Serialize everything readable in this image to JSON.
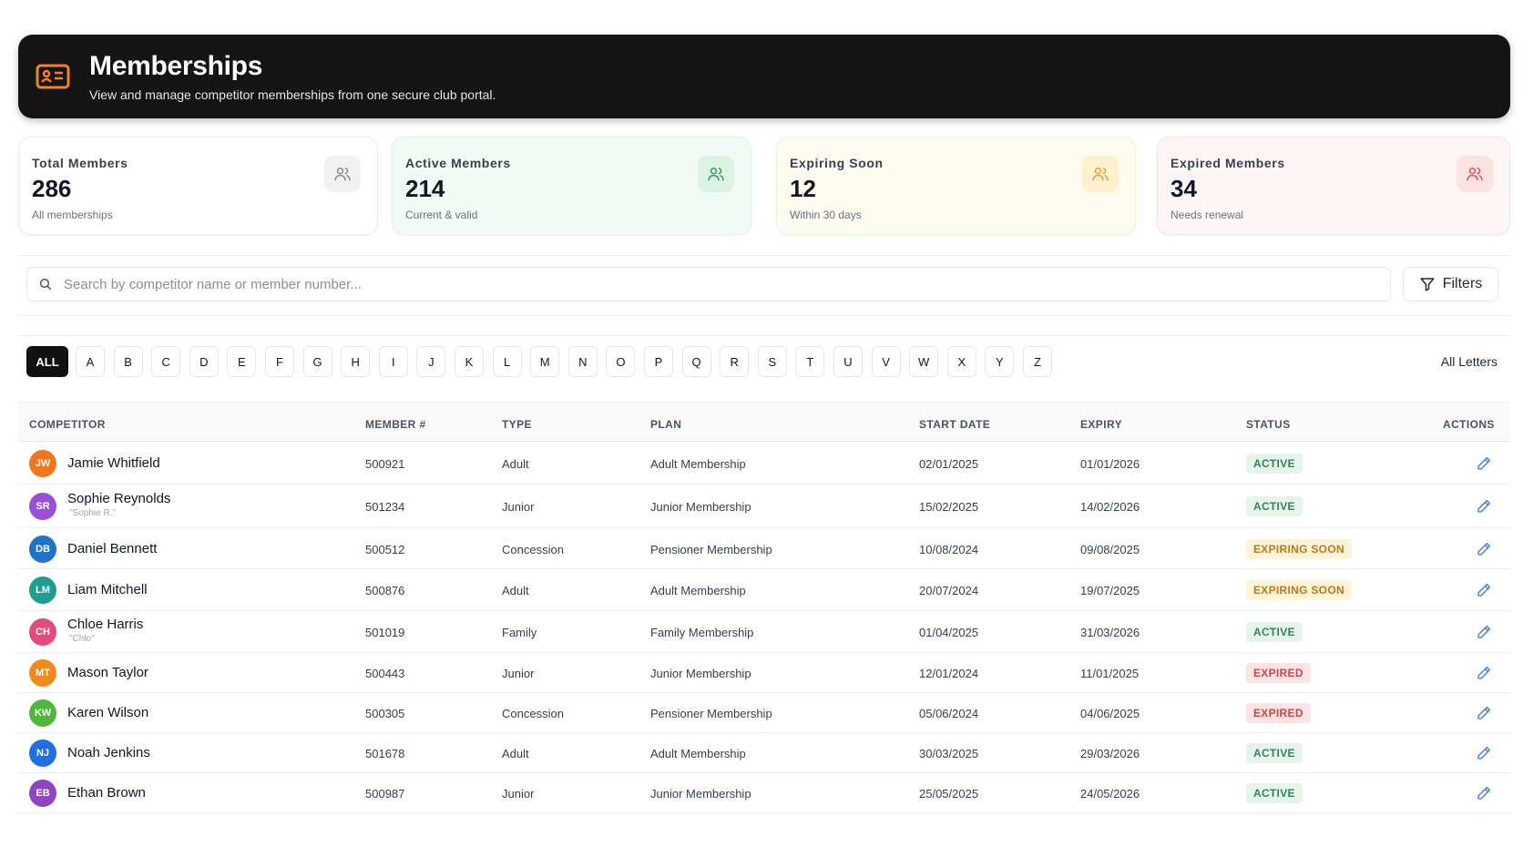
{
  "header": {
    "title": "Memberships",
    "subtitle": "View and manage competitor memberships from one secure club portal.",
    "icon": "id-card-icon",
    "accent": "#f58220"
  },
  "stats": [
    {
      "label": "Total Members",
      "value": "286",
      "sub": "All memberships",
      "icon": "users-icon",
      "color": "#8a8a8a"
    },
    {
      "label": "Active Members",
      "value": "214",
      "sub": "Current & valid",
      "icon": "users-icon",
      "color": "#2f9e5c"
    },
    {
      "label": "Expiring Soon",
      "value": "12",
      "sub": "Within 30 days",
      "icon": "users-icon",
      "color": "#e6a23c"
    },
    {
      "label": "Expired Members",
      "value": "34",
      "sub": "Needs renewal",
      "icon": "users-icon",
      "color": "#e05252"
    }
  ],
  "search": {
    "placeholder": "Search by competitor name or member number...",
    "value": ""
  },
  "filters_label": "Filters",
  "letters": [
    "ALL",
    "A",
    "B",
    "C",
    "D",
    "E",
    "F",
    "G",
    "H",
    "I",
    "J",
    "K",
    "L",
    "M",
    "N",
    "O",
    "P",
    "Q",
    "R",
    "S",
    "T",
    "U",
    "V",
    "W",
    "X",
    "Y",
    "Z"
  ],
  "selected_letter": "ALL",
  "all_letters_label": "All Letters",
  "table": {
    "headers": [
      "COMPETITOR",
      "MEMBER #",
      "TYPE",
      "PLAN",
      "START DATE",
      "EXPIRY",
      "STATUS",
      "ACTIONS"
    ],
    "rows": [
      {
        "initials": "JW",
        "color": "#f2761d",
        "name": "Jamie Whitfield",
        "nick": "",
        "member": "500921",
        "type": "Adult",
        "plan": "Adult Membership",
        "start": "02/01/2025",
        "expiry": "01/01/2026",
        "status": "ACTIVE",
        "status_kind": "active"
      },
      {
        "initials": "SR",
        "color": "#9b4fd6",
        "name": "Sophie Reynolds",
        "nick": "\"Sophie R.\"",
        "member": "501234",
        "type": "Junior",
        "plan": "Junior Membership",
        "start": "15/02/2025",
        "expiry": "14/02/2026",
        "status": "ACTIVE",
        "status_kind": "active"
      },
      {
        "initials": "DB",
        "color": "#1f73c8",
        "name": "Daniel Bennett",
        "nick": "",
        "member": "500512",
        "type": "Concession",
        "plan": "Pensioner Membership",
        "start": "10/08/2024",
        "expiry": "09/08/2025",
        "status": "EXPIRING SOON",
        "status_kind": "expiring"
      },
      {
        "initials": "LM",
        "color": "#1e9e93",
        "name": "Liam Mitchell",
        "nick": "",
        "member": "500876",
        "type": "Adult",
        "plan": "Adult Membership",
        "start": "20/07/2024",
        "expiry": "19/07/2025",
        "status": "EXPIRING SOON",
        "status_kind": "expiring"
      },
      {
        "initials": "CH",
        "color": "#e8497c",
        "name": "Chloe Harris",
        "nick": "\"Chlo\"",
        "member": "501019",
        "type": "Family",
        "plan": "Family Membership",
        "start": "01/04/2025",
        "expiry": "31/03/2026",
        "status": "ACTIVE",
        "status_kind": "active"
      },
      {
        "initials": "MT",
        "color": "#f2891d",
        "name": "Mason Taylor",
        "nick": "",
        "member": "500443",
        "type": "Junior",
        "plan": "Junior Membership",
        "start": "12/01/2024",
        "expiry": "11/01/2025",
        "status": "EXPIRED",
        "status_kind": "expired"
      },
      {
        "initials": "KW",
        "color": "#4fb83b",
        "name": "Karen Wilson",
        "nick": "",
        "member": "500305",
        "type": "Concession",
        "plan": "Pensioner Membership",
        "start": "05/06/2024",
        "expiry": "04/06/2025",
        "status": "EXPIRED",
        "status_kind": "expired"
      },
      {
        "initials": "NJ",
        "color": "#1f6fe0",
        "name": "Noah Jenkins",
        "nick": "",
        "member": "501678",
        "type": "Adult",
        "plan": "Adult Membership",
        "start": "30/03/2025",
        "expiry": "29/03/2026",
        "status": "ACTIVE",
        "status_kind": "active"
      },
      {
        "initials": "EB",
        "color": "#8e44c4",
        "name": "Ethan Brown",
        "nick": "",
        "member": "500987",
        "type": "Junior",
        "plan": "Junior Membership",
        "start": "25/05/2025",
        "expiry": "24/05/2026",
        "status": "ACTIVE",
        "status_kind": "active"
      }
    ],
    "action_icon": "pencil-icon",
    "action_color": "#3b7dd8"
  }
}
